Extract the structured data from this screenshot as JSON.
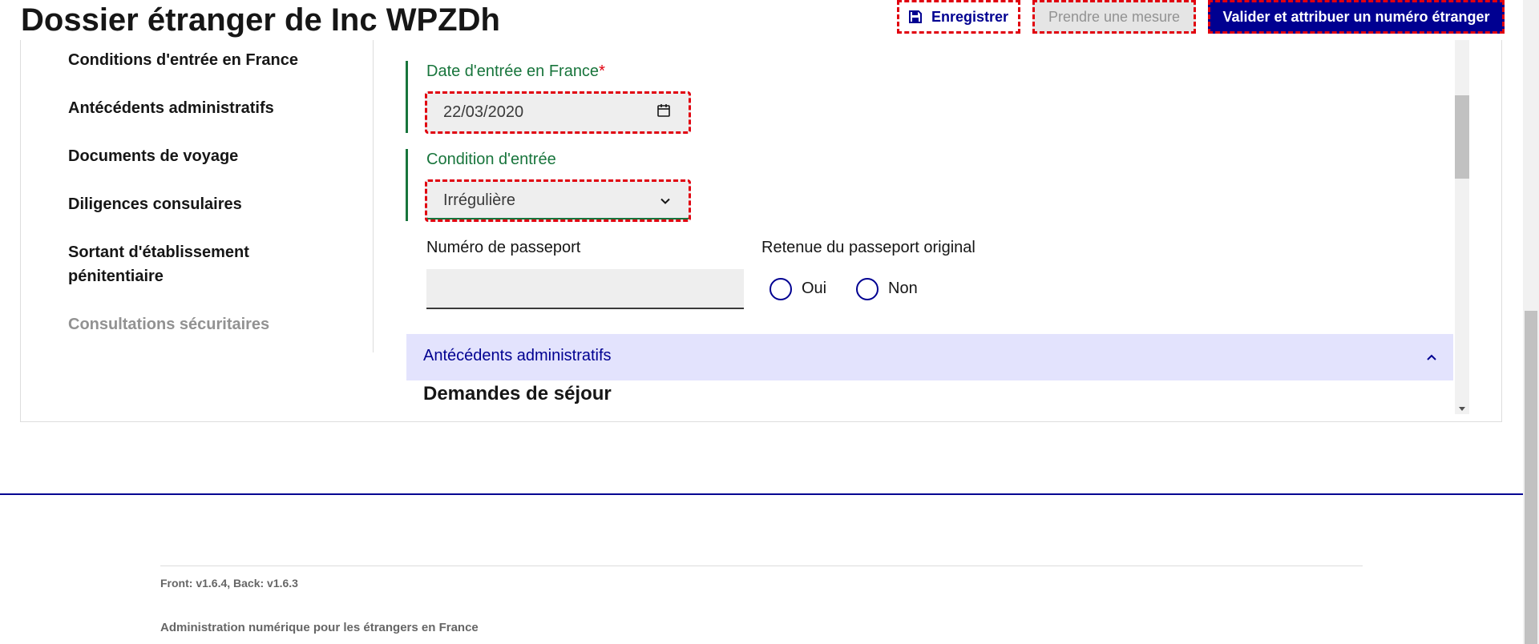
{
  "header": {
    "title": "Dossier étranger de Inc WPZDh",
    "save_label": "Enregistrer",
    "mesure_label": "Prendre une mesure",
    "valider_label": "Valider et attribuer un numéro étranger"
  },
  "sidebar": {
    "items": [
      {
        "label": "Conditions d'entrée en France"
      },
      {
        "label": "Antécédents administratifs"
      },
      {
        "label": "Documents de voyage"
      },
      {
        "label": "Diligences consulaires"
      },
      {
        "label": "Sortant d'établissement pénitentiaire"
      },
      {
        "label": "Consultations sécuritaires"
      }
    ]
  },
  "form": {
    "date_label": "Date d'entrée en France",
    "date_required": "*",
    "date_value": "22/03/2020",
    "condition_label": "Condition d'entrée",
    "condition_value": "Irrégulière",
    "passport_label": "Numéro de passeport",
    "passport_value": "",
    "retenue_label": "Retenue du passeport original",
    "option_oui": "Oui",
    "option_non": "Non"
  },
  "accordion": {
    "title": "Antécédents administratifs"
  },
  "section": {
    "title": "Demandes de séjour"
  },
  "footer": {
    "version": "Front: v1.6.4, Back: v1.6.3",
    "tagline": "Administration numérique pour les étrangers en France"
  },
  "colors": {
    "primary": "#000091",
    "success": "#18753c",
    "error": "#e1000f",
    "accordion_bg": "#e3e3fd"
  }
}
